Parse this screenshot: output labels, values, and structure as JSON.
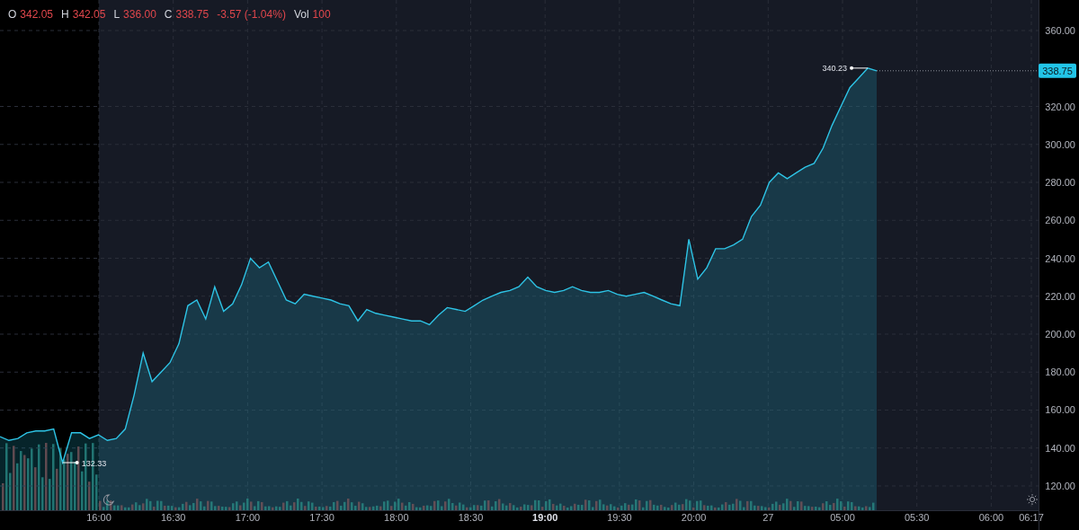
{
  "legend": {
    "ohlc": [
      {
        "label": "O",
        "value": "342.05"
      },
      {
        "label": "H",
        "value": "342.05"
      },
      {
        "label": "L",
        "value": "336.00"
      },
      {
        "label": "C",
        "value": "338.75"
      }
    ],
    "change": "-3.57 (-1.04%)",
    "volume": {
      "label": "Vol",
      "value": "100"
    }
  },
  "price_labels": {
    "high": "340.23",
    "low": "132.33",
    "last": "338.75"
  },
  "time_axis": [
    {
      "label": "16:00",
      "bold": false
    },
    {
      "label": "16:30",
      "bold": false
    },
    {
      "label": "17:00",
      "bold": false
    },
    {
      "label": "17:30",
      "bold": false
    },
    {
      "label": "18:00",
      "bold": false
    },
    {
      "label": "18:30",
      "bold": false
    },
    {
      "label": "19:00",
      "bold": true
    },
    {
      "label": "19:30",
      "bold": false
    },
    {
      "label": "20:00",
      "bold": false
    },
    {
      "label": "27",
      "bold": false
    },
    {
      "label": "05:00",
      "bold": false
    },
    {
      "label": "05:30",
      "bold": false
    },
    {
      "label": "06:00",
      "bold": false
    },
    {
      "label": "06:17",
      "bold": false
    }
  ],
  "chart_data": {
    "type": "area",
    "grid": true,
    "ylim": [
      96.8,
      376.1
    ],
    "yticks": [
      {
        "value": 120,
        "label": "120.00"
      },
      {
        "value": 140,
        "label": "140.00"
      },
      {
        "value": 160,
        "label": "160.00"
      },
      {
        "value": 180,
        "label": "180.00"
      },
      {
        "value": 200,
        "label": "200.00"
      },
      {
        "value": 220,
        "label": "220.00"
      },
      {
        "value": 240,
        "label": "240.00"
      },
      {
        "value": 260,
        "label": "260.00"
      },
      {
        "value": 280,
        "label": "280.00"
      },
      {
        "value": 300,
        "label": "300.00"
      },
      {
        "value": 320,
        "label": "320.00"
      },
      {
        "value": 360,
        "label": "360.00"
      }
    ],
    "series": [
      {
        "color": "#2ec4e6",
        "values": [
          146,
          144,
          145,
          148,
          149,
          149,
          150,
          132.3,
          148,
          148,
          145,
          147,
          144,
          145,
          150,
          168,
          190,
          175,
          180,
          185,
          195,
          215,
          218,
          208,
          225,
          212,
          216,
          226,
          240,
          235,
          238,
          228,
          218,
          216,
          221,
          220,
          219,
          218,
          216,
          215,
          207,
          213,
          211,
          210,
          209,
          208,
          207,
          207,
          205,
          210,
          214,
          213,
          212,
          215,
          218,
          220,
          222,
          223,
          225,
          230,
          225,
          223,
          222,
          223,
          225,
          223,
          222,
          222,
          223,
          221,
          220,
          221,
          222,
          220,
          218,
          216,
          215,
          250,
          229,
          235,
          245,
          245,
          247,
          250,
          262,
          268,
          280,
          285,
          282,
          285,
          288,
          290,
          298,
          310,
          320,
          330,
          335,
          340.2,
          338.8
        ]
      }
    ]
  }
}
